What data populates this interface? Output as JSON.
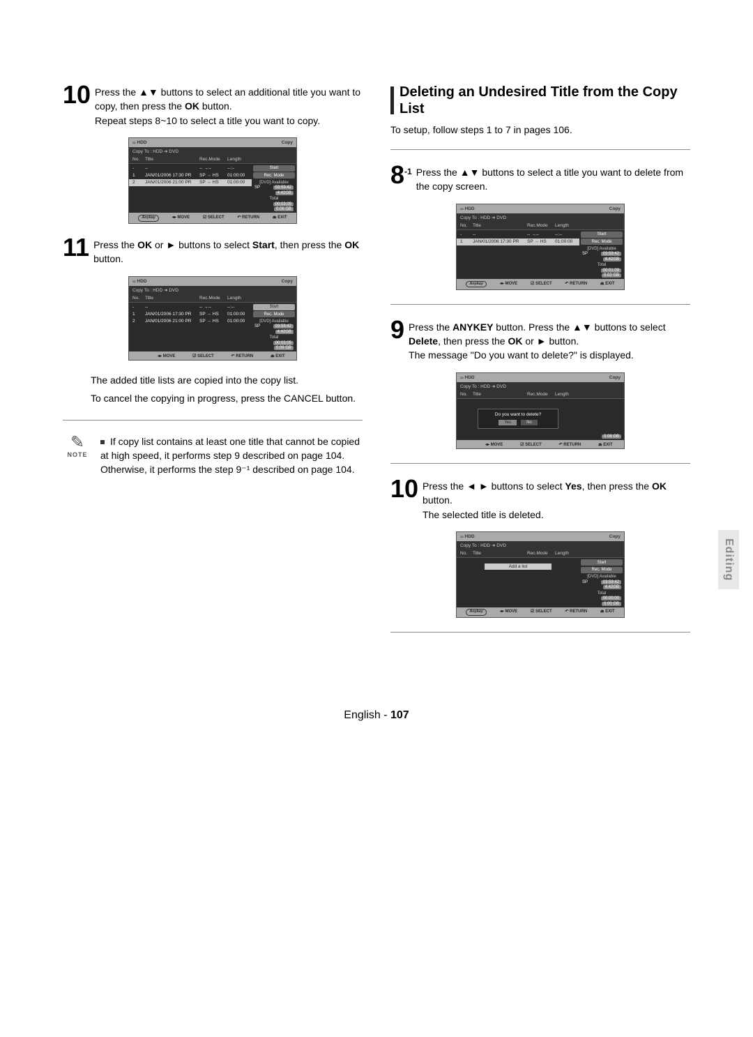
{
  "sideTab": "Editing",
  "footer": {
    "lang": "English -",
    "page": "107"
  },
  "left": {
    "step10": {
      "num": "10",
      "text_a": "Press the ",
      "arrows": "▲▼",
      "text_b": " buttons to select an additional title you want to copy, then press the ",
      "ok": "OK",
      "text_c": " button.",
      "repeat": "Repeat steps 8~10 to select a title you want to copy."
    },
    "step11": {
      "num": "11",
      "text_a": "Press the ",
      "ok1": "OK",
      "text_b": " or ",
      "play": "►",
      "text_c": " buttons to select ",
      "start": "Start",
      "text_d": ", then press the ",
      "ok2": "OK",
      "text_e": " button."
    },
    "after11_a": "The added title lists are copied into the copy list.",
    "after11_b_a": "To cancel the copying in progress, press the ",
    "after11_cancel": "CANCEL",
    "after11_b_b": " button.",
    "note": {
      "label": "NOTE",
      "text": "If copy list contains at least one title that cannot be copied at high speed, it performs step 9 described on page 104. Otherwise, it performs the step 9⁻¹ described on page 104."
    }
  },
  "right": {
    "heading": "Deleting an Undesired Title from the Copy List",
    "setup": "To setup, follow steps 1 to 7 in pages 106.",
    "step8": {
      "num": "8",
      "sup": "-1",
      "text_a": "Press the ",
      "arrows": "▲▼",
      "text_b": " buttons to select a title you want to delete from the copy screen."
    },
    "step9": {
      "num": "9",
      "text_a": "Press the ",
      "anykey": "ANYKEY",
      "text_b": " button. Press the ",
      "arrows": "▲▼",
      "text_c": " buttons to select ",
      "delete": "Delete",
      "text_d": ", then press the ",
      "ok": "OK",
      "text_e": " or ",
      "play": "►",
      "text_f": " button.",
      "msg": "The message \"Do you want to delete?\" is displayed."
    },
    "step10": {
      "num": "10",
      "text_a": "Press the ",
      "arrows": "◄ ►",
      "text_b": " buttons to select ",
      "yes": "Yes",
      "text_c": ", then press the ",
      "ok": "OK",
      "text_d": " button.",
      "result": "The selected title is deleted."
    }
  },
  "shot": {
    "hdd": "HDD",
    "copy": "Copy",
    "path": "Copy To : HDD  ➜  DVD",
    "h_no": "No.",
    "h_title": "Title",
    "h_mode": "Rec.Mode",
    "h_len": "Length",
    "ph_row": {
      "no": "- ",
      "title": "--",
      "mode": "-- →--",
      "len": "--:--"
    },
    "row1": {
      "no": "1",
      "title": "JAN/01/2006 17:30 PR",
      "mode": "SP → HS",
      "len": "01:00:00"
    },
    "row2": {
      "no": "2",
      "title": "JAN/01/2006 21:00 PR",
      "mode": "SP → HS",
      "len": "01:00:00"
    },
    "side": {
      "start": "Start",
      "recmode": "Rec. Mode",
      "avail": "[DVD] Available",
      "sp": "SP",
      "time1": "03:59:42",
      "size1": "4.42GB",
      "total": "Total",
      "time2a": "00:03:05",
      "size2a": "0.06 GB",
      "time2b": "00:01:09",
      "size2b": "0.02 GB",
      "time2c": "00:00:00",
      "size2c": "0.00 GB"
    },
    "foot": {
      "anykey": "Anykey",
      "move": "MOVE",
      "select": "SELECT",
      "return": "RETURN",
      "exit": "EXIT"
    },
    "dialog": {
      "q": "Do you want to delete?",
      "yes": "Yes",
      "no": "No"
    },
    "addlist": "Add a list"
  }
}
